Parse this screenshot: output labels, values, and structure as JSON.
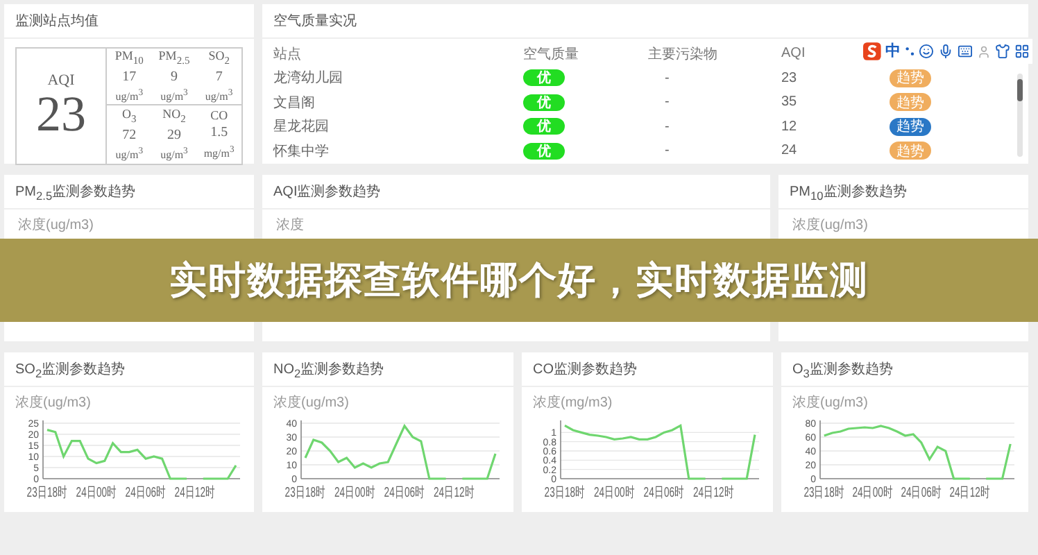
{
  "summary_card": {
    "title": "监测站点均值",
    "aqi_label": "AQI",
    "aqi_value": "23",
    "pollutants": [
      {
        "name": "PM$_{10}$",
        "value": "17",
        "unit": "ug/m$^{3}$"
      },
      {
        "name": "PM$_{2.5}$",
        "value": "9",
        "unit": "ug/m$^{3}$"
      },
      {
        "name": "SO$_{2}$",
        "value": "7",
        "unit": "ug/m$^{3}$"
      },
      {
        "name": "O$_{3}$",
        "value": "72",
        "unit": "ug/m$^{3}$"
      },
      {
        "name": "NO$_{2}$",
        "value": "29",
        "unit": "ug/m$^{3}$"
      },
      {
        "name": "CO",
        "value": "1.5",
        "unit": "mg/m$^{3}$"
      }
    ]
  },
  "quality_card": {
    "title": "空气质量实况",
    "columns": [
      "站点",
      "空气质量",
      "主要污染物",
      "AQI"
    ],
    "rows": [
      {
        "station": "龙湾幼儿园",
        "quality": "优",
        "pollutant": "-",
        "aqi": "23",
        "trend": "趋势",
        "selected": false
      },
      {
        "station": "文昌阁",
        "quality": "优",
        "pollutant": "-",
        "aqi": "35",
        "trend": "趋势",
        "selected": false
      },
      {
        "station": "星龙花园",
        "quality": "优",
        "pollutant": "-",
        "aqi": "12",
        "trend": "趋势",
        "selected": true
      },
      {
        "station": "怀集中学",
        "quality": "优",
        "pollutant": "-",
        "aqi": "24",
        "trend": "趋势",
        "selected": false
      }
    ]
  },
  "ime_toolbar": {
    "mode": "中"
  },
  "trend_cards": [
    {
      "title": "PM$_{2.5}$监测参数趋势",
      "axis_label": "浓度(ug/m3)"
    },
    {
      "title": "AQI监测参数趋势",
      "axis_label": "浓度"
    },
    {
      "title": "PM$_{10}$监测参数趋势",
      "axis_label": "浓度(ug/m3)"
    }
  ],
  "banner": {
    "text": "实时数据探查软件哪个好，实时数据监测"
  },
  "chart_cards": [
    {
      "title": "SO$_{2}$监测参数趋势",
      "chart_data": {
        "type": "line",
        "ylabel": "浓度(ug/m3)",
        "categories": [
          "23日18时",
          null,
          null,
          null,
          null,
          null,
          "24日00时",
          null,
          null,
          null,
          null,
          null,
          "24日06时",
          null,
          null,
          null,
          null,
          null,
          "24日12时",
          null,
          null,
          null,
          null,
          null
        ],
        "ylim": [
          0,
          25
        ],
        "yticks": [
          0,
          5,
          10,
          15,
          20,
          25
        ],
        "grid": true,
        "series": [
          {
            "color": "#6fd66f",
            "values": [
              22,
              21,
              10,
              17,
              17,
              9,
              7,
              8,
              16,
              12,
              12,
              13,
              9,
              10,
              9,
              0,
              0,
              0,
              null,
              0,
              0,
              0,
              0,
              6
            ]
          }
        ]
      }
    },
    {
      "title": "NO$_{2}$监测参数趋势",
      "chart_data": {
        "type": "line",
        "ylabel": "浓度(ug/m3)",
        "categories": [
          "23日18时",
          null,
          null,
          null,
          null,
          null,
          "24日00时",
          null,
          null,
          null,
          null,
          null,
          "24日06时",
          null,
          null,
          null,
          null,
          null,
          "24日12时",
          null,
          null,
          null,
          null,
          null
        ],
        "ylim": [
          0,
          40
        ],
        "yticks": [
          0,
          10,
          20,
          30,
          40
        ],
        "grid": true,
        "series": [
          {
            "color": "#6fd66f",
            "values": [
              15,
              28,
              26,
              20,
              12,
              15,
              8,
              11,
              8,
              11,
              12,
              25,
              38,
              30,
              27,
              0,
              0,
              0,
              null,
              0,
              0,
              0,
              0,
              18
            ]
          }
        ]
      }
    },
    {
      "title": "CO监测参数趋势",
      "chart_data": {
        "type": "line",
        "ylabel": "浓度(mg/m3)",
        "categories": [
          "23日18时",
          null,
          null,
          null,
          null,
          null,
          "24日00时",
          null,
          null,
          null,
          null,
          null,
          "24日06时",
          null,
          null,
          null,
          null,
          null,
          "24日12时",
          null,
          null,
          null,
          null,
          null
        ],
        "ylim": [
          0,
          1.2
        ],
        "yticks": [
          0,
          0.2,
          0.4,
          0.6,
          0.8,
          1
        ],
        "grid": true,
        "series": [
          {
            "color": "#6fd66f",
            "values": [
              1.15,
              1.05,
              1.0,
              0.95,
              0.93,
              0.9,
              0.85,
              0.87,
              0.9,
              0.85,
              0.85,
              0.9,
              1.0,
              1.05,
              1.15,
              0,
              0,
              0,
              null,
              0,
              0,
              0,
              0,
              0.95
            ]
          }
        ]
      }
    },
    {
      "title": "O$_{3}$监测参数趋势",
      "chart_data": {
        "type": "line",
        "ylabel": "浓度(ug/m3)",
        "categories": [
          "23日18时",
          null,
          null,
          null,
          null,
          null,
          "24日00时",
          null,
          null,
          null,
          null,
          null,
          "24日06时",
          null,
          null,
          null,
          null,
          null,
          "24日12时",
          null,
          null,
          null,
          null,
          null
        ],
        "ylim": [
          0,
          80
        ],
        "yticks": [
          0,
          20,
          40,
          60,
          80
        ],
        "grid": true,
        "series": [
          {
            "color": "#6fd66f",
            "values": [
              62,
              66,
              68,
              72,
              73,
              74,
              73,
              76,
              73,
              68,
              62,
              64,
              52,
              28,
              46,
              40,
              0,
              0,
              0,
              null,
              0,
              0,
              0,
              50
            ]
          }
        ]
      }
    }
  ]
}
